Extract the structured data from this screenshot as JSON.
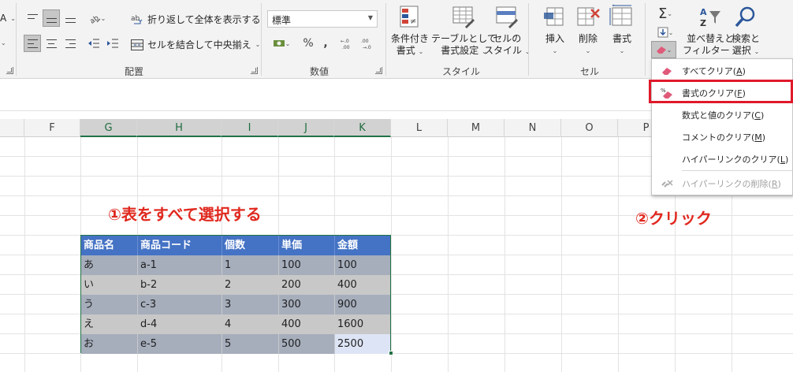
{
  "ribbon": {
    "alignment": {
      "label": "配置",
      "wrap_text": "折り返して全体を表示する",
      "merge_center": "セルを結合して中央揃え",
      "orientation_icon": "ab-orientation-icon"
    },
    "number": {
      "label": "数値",
      "format_value": "標準",
      "currency_icon": "currency-icon",
      "percent": "%",
      "comma": ","
    },
    "styles": {
      "label": "スタイル",
      "conditional_1": "条件付き",
      "conditional_2": "書式",
      "table_1": "テーブルとして",
      "table_2": "書式設定",
      "cell_1": "セルの",
      "cell_2": "スタイル"
    },
    "cells": {
      "label": "セル",
      "insert": "挿入",
      "delete": "削除",
      "format": "書式"
    },
    "editing": {
      "sort_1": "並べ替えと",
      "sort_2": "フィルター",
      "find_1": "検索と",
      "find_2": "選択",
      "sigma": "Σ"
    },
    "left_cut": "A"
  },
  "columns": [
    "F",
    "G",
    "H",
    "I",
    "J",
    "K",
    "L",
    "M",
    "N",
    "O",
    "P"
  ],
  "selected_columns": [
    "G",
    "H",
    "I",
    "J",
    "K"
  ],
  "table": {
    "headers": [
      "商品名",
      "商品コード",
      "個数",
      "単価",
      "金額"
    ],
    "rows": [
      [
        "あ",
        "a-1",
        "1",
        "100",
        "100"
      ],
      [
        "い",
        "b-2",
        "2",
        "200",
        "400"
      ],
      [
        "う",
        "c-3",
        "3",
        "300",
        "900"
      ],
      [
        "え",
        "d-4",
        "4",
        "400",
        "1600"
      ],
      [
        "お",
        "e-5",
        "5",
        "500",
        "2500"
      ]
    ]
  },
  "annotations": {
    "step1": "①表をすべて選択する",
    "step2": "②クリック"
  },
  "clear_menu": {
    "clear_all": {
      "text": "すべてクリア(",
      "key": "A",
      "close": ")"
    },
    "clear_formats": {
      "text": "書式のクリア(",
      "key": "F",
      "close": ")"
    },
    "clear_contents": {
      "text": "数式と値のクリア(",
      "key": "C",
      "close": ")"
    },
    "clear_comments": {
      "text": "コメントのクリア(",
      "key": "M",
      "close": ")"
    },
    "clear_hyperlinks": {
      "text": "ハイパーリンクのクリア(",
      "key": "L",
      "close": ")"
    },
    "remove_hyperlinks": {
      "text": "ハイパーリンクの削除(",
      "key": "R",
      "close": ")"
    }
  },
  "colors": {
    "excel_green": "#217346",
    "header_blue": "#4472c4",
    "annotation_red": "#e0281e",
    "highlight_red": "#e0192b"
  }
}
